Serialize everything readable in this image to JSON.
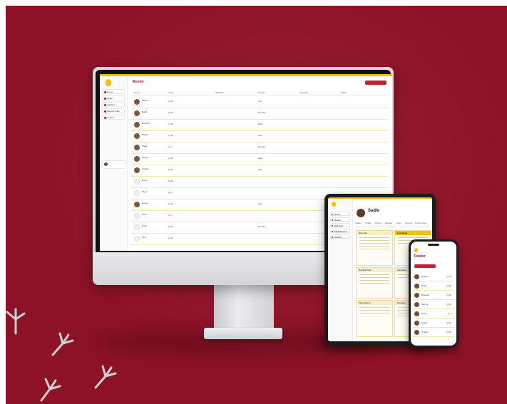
{
  "scene": {
    "background_color": "#8e1227",
    "accent_yellow": "#f2c200",
    "accent_red": "#c61f34"
  },
  "desktop_app": {
    "page_title": "Roster",
    "nav_items": [
      "Home",
      "Roster",
      "Add Hen",
      "Medical Care",
      "Genetic"
    ],
    "table_headers": [
      "Name",
      "Code",
      "Hatched",
      "Gender",
      "Acquired",
      "Status"
    ],
    "rows": [
      {
        "name": "Beatrix",
        "code": "Q-16",
        "gender": "Hen"
      },
      {
        "name": "Bellis",
        "code": "Q-16",
        "gender": "Female"
      },
      {
        "name": "Brunello",
        "code": "Q-16",
        "gender": "Male"
      },
      {
        "name": "Bianca",
        "code": "Q-16",
        "gender": "Hen"
      },
      {
        "name": "Clara",
        "code": "Q-1",
        "gender": "Female"
      },
      {
        "name": "Sergio",
        "code": "Q-16",
        "gender": "Male"
      },
      {
        "name": "Charlie",
        "code": "Q-16",
        "gender": "Hen"
      },
      {
        "name": "Brent",
        "code": "Q-16",
        "gender": ""
      },
      {
        "name": "Tiger",
        "code": "Q-1",
        "gender": ""
      },
      {
        "name": "Emma",
        "code": "Q-16",
        "gender": "Hen"
      },
      {
        "name": "Rose",
        "code": "Q-1",
        "gender": ""
      },
      {
        "name": "Dolly",
        "code": "Q-16",
        "gender": "Female"
      },
      {
        "name": "Tilly",
        "code": "Q-16",
        "gender": ""
      }
    ]
  },
  "tablet_app": {
    "profile_name": "Sadie",
    "nav_items": [
      "Home",
      "Roster",
      "Add Hen",
      "Medical Care",
      "Genetic"
    ],
    "tabs": [
      "Status",
      "Profile",
      "Photos",
      "Medical",
      "Eggs",
      "Genetic",
      "Preferences"
    ],
    "cards": [
      "Hen info",
      "Last Eggs",
      "General Info",
      "Vaccines",
      "Vaccination",
      "Disease"
    ]
  },
  "phone_app": {
    "page_title": "Roster",
    "rows": [
      {
        "name": "Beatrix",
        "code": "Q-16"
      },
      {
        "name": "Bellis",
        "code": "Q-16"
      },
      {
        "name": "Brunello",
        "code": "Q-16"
      },
      {
        "name": "Bianca",
        "code": "Q-16"
      },
      {
        "name": "Clara",
        "code": "Q-1"
      },
      {
        "name": "Sergio",
        "code": "Q-16"
      },
      {
        "name": "Charlie",
        "code": "Q-16"
      }
    ]
  }
}
